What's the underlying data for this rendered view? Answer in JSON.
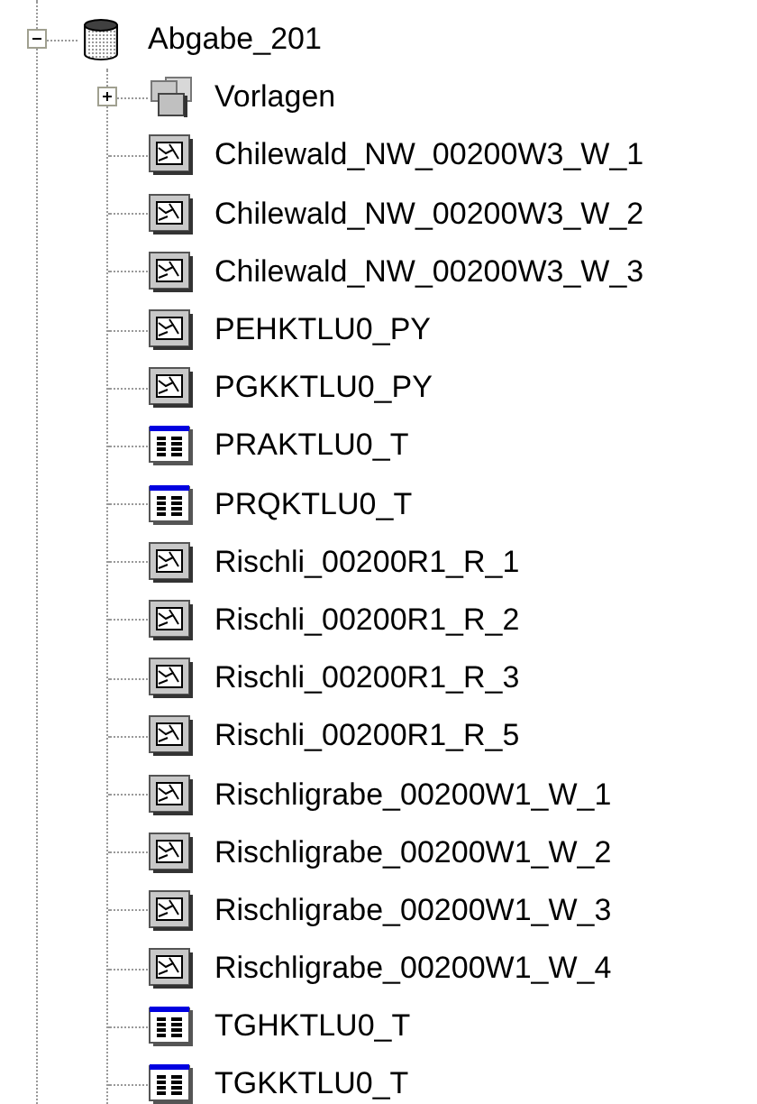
{
  "tree": {
    "label": "Abgabe_201",
    "kind": "database",
    "expanded": true,
    "children": [
      {
        "label": "Vorlagen",
        "kind": "group",
        "expanded": false
      },
      {
        "label": "Chilewald_NW_00200W3_W_1",
        "kind": "feature"
      },
      {
        "label": "Chilewald_NW_00200W3_W_2",
        "kind": "feature"
      },
      {
        "label": "Chilewald_NW_00200W3_W_3",
        "kind": "feature"
      },
      {
        "label": "PEHKTLU0_PY",
        "kind": "feature"
      },
      {
        "label": "PGKKTLU0_PY",
        "kind": "feature"
      },
      {
        "label": "PRAKTLU0_T",
        "kind": "table"
      },
      {
        "label": "PRQKTLU0_T",
        "kind": "table"
      },
      {
        "label": "Rischli_00200R1_R_1",
        "kind": "feature"
      },
      {
        "label": "Rischli_00200R1_R_2",
        "kind": "feature"
      },
      {
        "label": "Rischli_00200R1_R_3",
        "kind": "feature"
      },
      {
        "label": "Rischli_00200R1_R_5",
        "kind": "feature"
      },
      {
        "label": "Rischligrabe_00200W1_W_1",
        "kind": "feature"
      },
      {
        "label": "Rischligrabe_00200W1_W_2",
        "kind": "feature"
      },
      {
        "label": "Rischligrabe_00200W1_W_3",
        "kind": "feature"
      },
      {
        "label": "Rischligrabe_00200W1_W_4",
        "kind": "feature"
      },
      {
        "label": "TGHKTLU0_T",
        "kind": "table"
      },
      {
        "label": "TGKKTLU0_T",
        "kind": "table"
      }
    ]
  }
}
